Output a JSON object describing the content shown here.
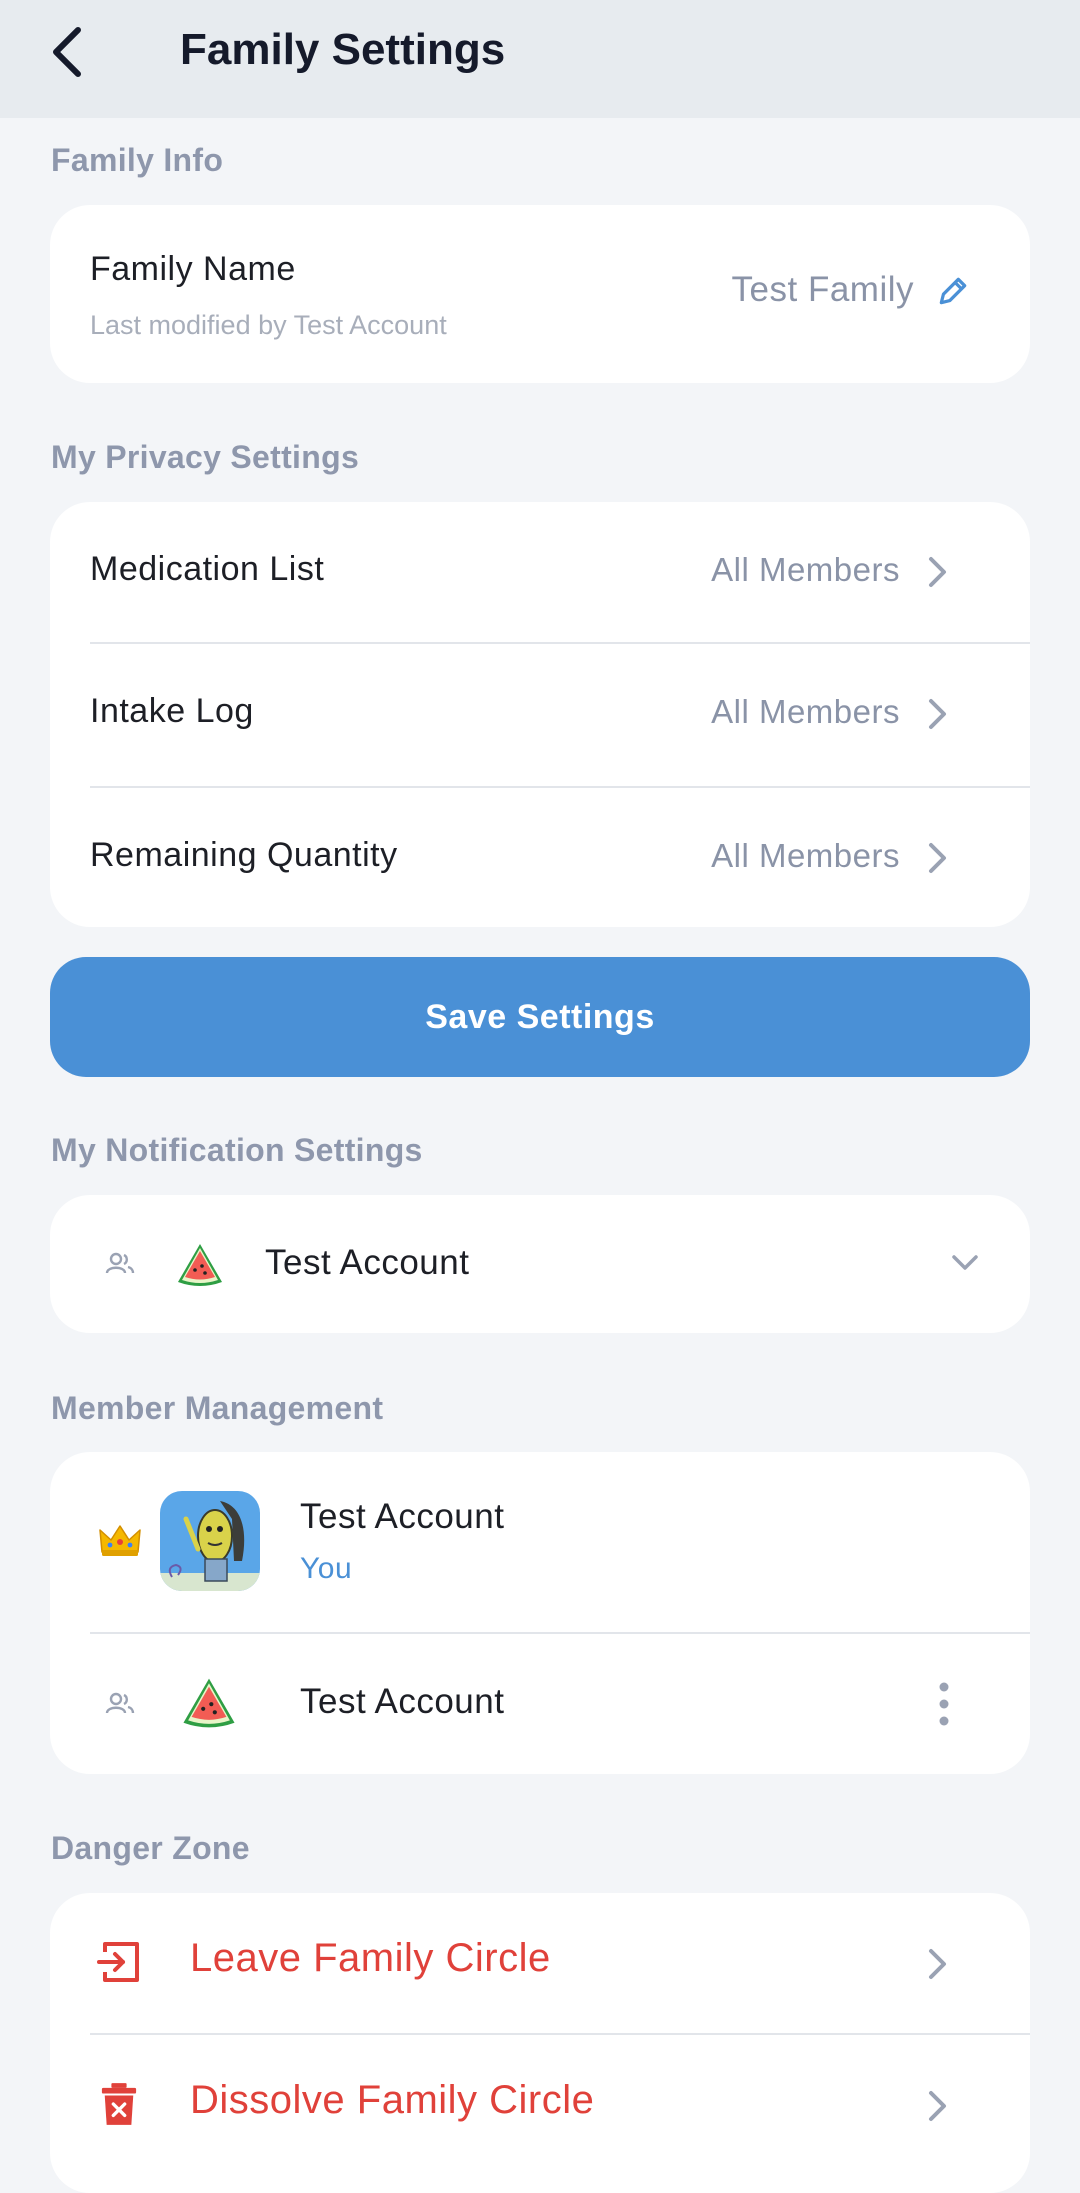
{
  "header": {
    "title": "Family Settings",
    "back_icon": "chevron-left-icon"
  },
  "family_info": {
    "section_label": "Family Info",
    "family_name_label": "Family Name",
    "last_modified": "Last modified by Test Account",
    "family_name_value": "Test Family",
    "edit_icon": "pencil-icon"
  },
  "privacy": {
    "section_label": "My Privacy Settings",
    "items": [
      {
        "label": "Medication List",
        "value": "All Members"
      },
      {
        "label": "Intake Log",
        "value": "All Members"
      },
      {
        "label": "Remaining Quantity",
        "value": "All Members"
      }
    ]
  },
  "save_button": {
    "label": "Save Settings"
  },
  "notifications": {
    "section_label": "My Notification Settings",
    "member_name": "Test Account",
    "icons": [
      "people-icon",
      "watermelon-icon",
      "chevron-down-icon"
    ]
  },
  "members": {
    "section_label": "Member Management",
    "list": [
      {
        "name": "Test Account",
        "tag": "You",
        "role_icon": "crown-icon"
      },
      {
        "name": "Test Account",
        "role_icon": "people-icon"
      }
    ]
  },
  "danger": {
    "section_label": "Danger Zone",
    "leave_label": "Leave Family Circle",
    "dissolve_label": "Dissolve Family Circle"
  },
  "colors": {
    "accent": "#4a90d6",
    "danger": "#e0413a",
    "background": "#f3f5f8",
    "header_bg": "#e7ebef"
  }
}
